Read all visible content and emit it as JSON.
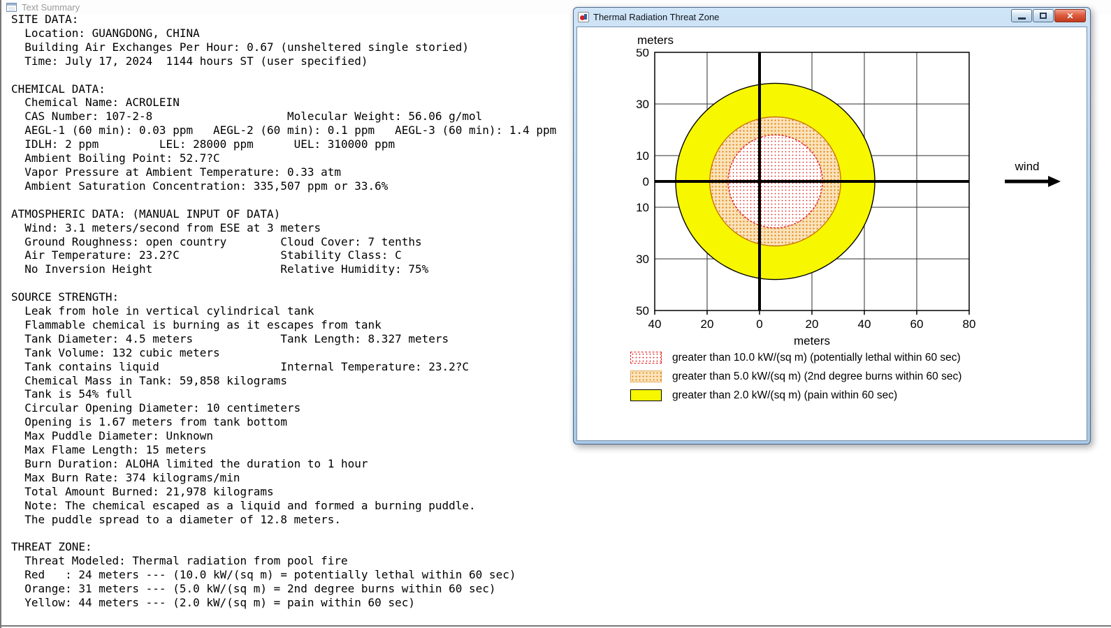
{
  "text_summary": {
    "title": "Text Summary",
    "lines": [
      "SITE DATA:",
      "  Location: GUANGDONG, CHINA",
      "  Building Air Exchanges Per Hour: 0.67 (unsheltered single storied)",
      "  Time: July 17, 2024  1144 hours ST (user specified)",
      "",
      "CHEMICAL DATA:",
      "  Chemical Name: ACROLEIN",
      "  CAS Number: 107-2-8                    Molecular Weight: 56.06 g/mol",
      "  AEGL-1 (60 min): 0.03 ppm   AEGL-2 (60 min): 0.1 ppm   AEGL-3 (60 min): 1.4 ppm",
      "  IDLH: 2 ppm         LEL: 28000 ppm      UEL: 310000 ppm",
      "  Ambient Boiling Point: 52.7?C",
      "  Vapor Pressure at Ambient Temperature: 0.33 atm",
      "  Ambient Saturation Concentration: 335,507 ppm or 33.6%",
      "",
      "ATMOSPHERIC DATA: (MANUAL INPUT OF DATA)",
      "  Wind: 3.1 meters/second from ESE at 3 meters",
      "  Ground Roughness: open country        Cloud Cover: 7 tenths",
      "  Air Temperature: 23.2?C               Stability Class: C",
      "  No Inversion Height                   Relative Humidity: 75%",
      "",
      "SOURCE STRENGTH:",
      "  Leak from hole in vertical cylindrical tank",
      "  Flammable chemical is burning as it escapes from tank",
      "  Tank Diameter: 4.5 meters             Tank Length: 8.327 meters",
      "  Tank Volume: 132 cubic meters",
      "  Tank contains liquid                  Internal Temperature: 23.2?C",
      "  Chemical Mass in Tank: 59,858 kilograms",
      "  Tank is 54% full",
      "  Circular Opening Diameter: 10 centimeters",
      "  Opening is 1.67 meters from tank bottom",
      "  Max Puddle Diameter: Unknown",
      "  Max Flame Length: 15 meters",
      "  Burn Duration: ALOHA limited the duration to 1 hour",
      "  Max Burn Rate: 374 kilograms/min",
      "  Total Amount Burned: 21,978 kilograms",
      "  Note: The chemical escaped as a liquid and formed a burning puddle.",
      "  The puddle spread to a diameter of 12.8 meters.",
      "",
      "THREAT ZONE:",
      "  Threat Modeled: Thermal radiation from pool fire",
      "  Red   : 24 meters --- (10.0 kW/(sq m) = potentially lethal within 60 sec)",
      "  Orange: 31 meters --- (5.0 kW/(sq m) = 2nd degree burns within 60 sec)",
      "  Yellow: 44 meters --- (2.0 kW/(sq m) = pain within 60 sec)"
    ]
  },
  "threat_window": {
    "title": "Thermal Radiation Threat Zone",
    "close_glyph": "✕"
  },
  "chart_data": {
    "type": "threat-zone-map",
    "title": "Thermal Radiation Threat Zone",
    "xlabel": "meters",
    "ylabel": "meters",
    "xlim": [
      -40,
      80
    ],
    "ylim": [
      -50,
      50
    ],
    "grid_step": 20,
    "grid": true,
    "x_tick_values": [
      -40,
      -20,
      0,
      20,
      40,
      60,
      80
    ],
    "x_tick_labels": [
      "40",
      "20",
      "0",
      "20",
      "40",
      "60",
      "80"
    ],
    "y_tick_values": [
      50,
      30,
      10,
      0,
      -10,
      -30,
      -50
    ],
    "y_tick_labels": [
      "50",
      "30",
      "10",
      "0",
      "10",
      "30",
      "50"
    ],
    "wind_label": "wind",
    "center": [
      6,
      0
    ],
    "zones": [
      {
        "name": "yellow",
        "threshold": "2.0 kW/(sq m)",
        "extent_m": 44,
        "plot_radius_m": 38,
        "fill": "#f7f700",
        "stroke": "#000000",
        "pattern": "solid"
      },
      {
        "name": "orange",
        "threshold": "5.0 kW/(sq m)",
        "extent_m": 31,
        "plot_radius_m": 25,
        "fill": "#fbe3bd",
        "dot": "#e08000",
        "stroke": "#c87800",
        "pattern": "dots"
      },
      {
        "name": "red",
        "threshold": "10.0 kW/(sq m)",
        "extent_m": 24,
        "plot_radius_m": 18,
        "fill": "#ffffff",
        "dot": "#e02020",
        "stroke": "#e02020",
        "pattern": "dots"
      }
    ],
    "legend": [
      {
        "label": "greater than 10.0 kW/(sq m) (potentially lethal within 60 sec)",
        "swatch": "red"
      },
      {
        "label": "greater than 5.0 kW/(sq m) (2nd degree burns within 60 sec)",
        "swatch": "orange"
      },
      {
        "label": "greater than 2.0 kW/(sq m) (pain within 60 sec)",
        "swatch": "yellow"
      }
    ]
  }
}
